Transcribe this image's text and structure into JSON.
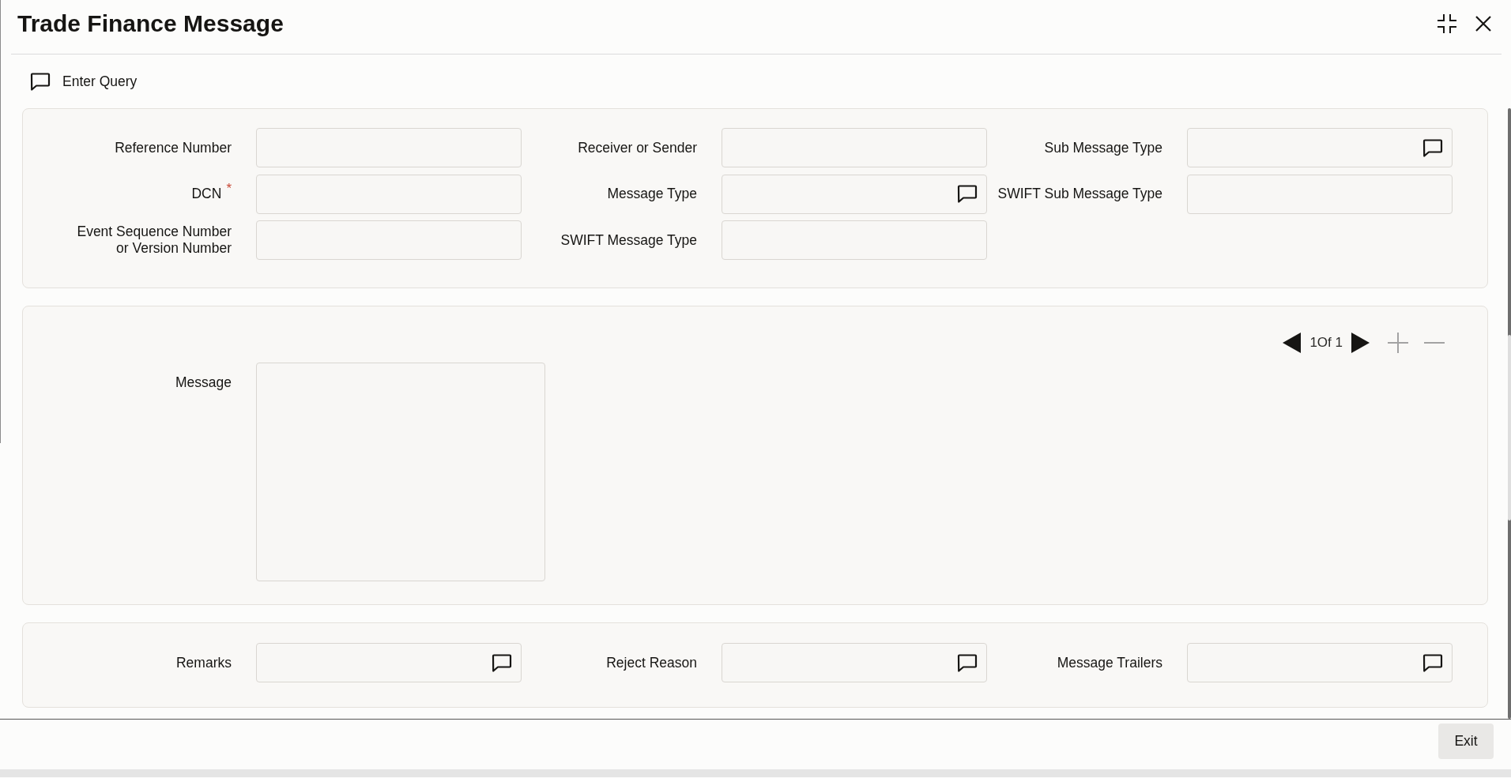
{
  "window": {
    "title": "Trade Finance Message"
  },
  "toolbar": {
    "enter_query": "Enter Query"
  },
  "header_fields": [
    {
      "label": "Reference Number",
      "lookup": false
    },
    {
      "label": "Receiver or Sender",
      "lookup": false
    },
    {
      "label": "Sub Message Type",
      "lookup": true
    },
    {
      "label": "DCN",
      "required_mark": "*",
      "lookup": false
    },
    {
      "label": "Message Type",
      "lookup": true
    },
    {
      "label": "SWIFT Sub Message Type",
      "lookup": false
    },
    {
      "label": "Event Sequence Number\nor Version Number",
      "lookup": false
    },
    {
      "label": "SWIFT Message Type",
      "lookup": false
    }
  ],
  "message_panel": {
    "pager": {
      "previous": {
        "disabled": false
      },
      "page_text": "1Of 1",
      "next": {
        "disabled": false
      },
      "add": {
        "disabled": true
      },
      "remove": {
        "disabled": true
      }
    },
    "message": {
      "label": "Message"
    }
  },
  "footer_fields": [
    {
      "label": "Remarks",
      "lookup": true
    },
    {
      "label": "Reject Reason",
      "lookup": true
    },
    {
      "label": "Message Trailers",
      "lookup": true
    }
  ],
  "buttons": [
    {
      "label": "Exit"
    }
  ]
}
